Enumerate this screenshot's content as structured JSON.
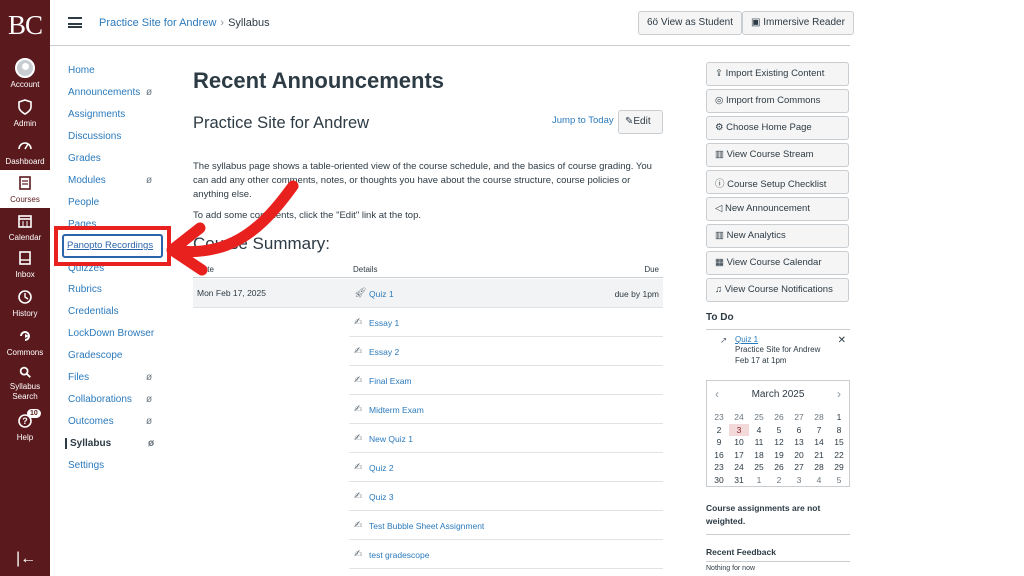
{
  "global_nav": {
    "logo": "BC",
    "items": [
      {
        "label": "Account",
        "icon": "avatar"
      },
      {
        "label": "Admin",
        "icon": "shield-icon"
      },
      {
        "label": "Dashboard",
        "icon": "dashboard-icon"
      },
      {
        "label": "Courses",
        "icon": "book-icon"
      },
      {
        "label": "Calendar",
        "icon": "calendar-icon"
      },
      {
        "label": "Inbox",
        "icon": "inbox-icon"
      },
      {
        "label": "History",
        "icon": "clock-icon"
      },
      {
        "label": "Commons",
        "icon": "commons-icon"
      },
      {
        "label": "Syllabus Search",
        "icon": "search-icon"
      },
      {
        "label": "Help",
        "icon": "help-icon",
        "badge": "10"
      }
    ],
    "collapse": "|←"
  },
  "header": {
    "breadcrumb_course": "Practice Site for Andrew",
    "breadcrumb_sep": "›",
    "breadcrumb_page": "Syllabus",
    "view_as_student": "View as Student",
    "immersive_reader": "Immersive Reader"
  },
  "course_nav": {
    "items": [
      {
        "label": "Home"
      },
      {
        "label": "Announcements",
        "hidden": true
      },
      {
        "label": "Assignments"
      },
      {
        "label": "Discussions"
      },
      {
        "label": "Grades"
      },
      {
        "label": "Modules",
        "hidden": true
      },
      {
        "label": "People"
      },
      {
        "label": "Pages"
      },
      {
        "label": "Panopto Recordings"
      },
      {
        "label": "Quizzes"
      },
      {
        "label": "Rubrics"
      },
      {
        "label": "Credentials"
      },
      {
        "label": "LockDown Browser"
      },
      {
        "label": "Gradescope"
      },
      {
        "label": "Files",
        "hidden": true
      },
      {
        "label": "Collaborations",
        "hidden": true
      },
      {
        "label": "Outcomes",
        "hidden": true
      },
      {
        "label": "Syllabus",
        "hidden": true,
        "active": true
      },
      {
        "label": "Settings"
      }
    ]
  },
  "main": {
    "title": "Recent Announcements",
    "course_title": "Practice Site for Andrew",
    "jump_to_today": "Jump to Today",
    "edit": "Edit",
    "description": "The syllabus page shows a table-oriented view of the course schedule, and the basics of course grading. You can add any other comments, notes, or thoughts you have about the course structure, course policies or anything else.",
    "edit_hint": "To add some comments, click the \"Edit\" link at the top.",
    "summary_title": "Course Summary:",
    "table": {
      "headers": {
        "date": "Date",
        "details": "Details",
        "due": "Due"
      },
      "date": "Mon Feb 17, 2025",
      "rows": [
        {
          "name": "Quiz 1",
          "due": "due by 1pm",
          "icon": "quiz-icon"
        },
        {
          "name": "Essay 1",
          "due": "",
          "icon": "assignment-icon"
        },
        {
          "name": "Essay 2",
          "due": "",
          "icon": "assignment-icon"
        },
        {
          "name": "Final Exam",
          "due": "",
          "icon": "assignment-icon"
        },
        {
          "name": "Midterm Exam",
          "due": "",
          "icon": "assignment-icon"
        },
        {
          "name": "New Quiz 1",
          "due": "",
          "icon": "assignment-icon"
        },
        {
          "name": "Quiz 2",
          "due": "",
          "icon": "assignment-icon"
        },
        {
          "name": "Quiz 3",
          "due": "",
          "icon": "assignment-icon"
        },
        {
          "name": "Test Bubble Sheet Assignment",
          "due": "",
          "icon": "assignment-icon"
        },
        {
          "name": "test gradescope",
          "due": "",
          "icon": "assignment-icon"
        }
      ]
    }
  },
  "sidebar": {
    "buttons": [
      {
        "label": "Import Existing Content",
        "icon": "import-icon"
      },
      {
        "label": "Import from Commons",
        "icon": "commons-icon"
      },
      {
        "label": "Choose Home Page",
        "icon": "home-icon"
      },
      {
        "label": "View Course Stream",
        "icon": "stream-icon"
      },
      {
        "label": "Course Setup Checklist",
        "icon": "checklist-icon"
      },
      {
        "label": "New Announcement",
        "icon": "announcement-icon"
      },
      {
        "label": "New Analytics",
        "icon": "analytics-icon"
      },
      {
        "label": "View Course Calendar",
        "icon": "calendar-icon"
      },
      {
        "label": "View Course Notifications",
        "icon": "bell-icon"
      }
    ],
    "todo": {
      "heading": "To Do",
      "item_name": "Quiz 1",
      "item_course": "Practice Site for Andrew",
      "item_date": "Feb 17 at 1pm",
      "close": "✕"
    },
    "calendar": {
      "month": "March 2025",
      "weeks": [
        [
          "23",
          "24",
          "25",
          "26",
          "27",
          "28",
          "1"
        ],
        [
          "2",
          "3",
          "4",
          "5",
          "6",
          "7",
          "8"
        ],
        [
          "9",
          "10",
          "11",
          "12",
          "13",
          "14",
          "15"
        ],
        [
          "16",
          "17",
          "18",
          "19",
          "20",
          "21",
          "22"
        ],
        [
          "23",
          "24",
          "25",
          "26",
          "27",
          "28",
          "29"
        ],
        [
          "30",
          "31",
          "1",
          "2",
          "3",
          "4",
          "5"
        ]
      ],
      "today": "3"
    },
    "weight_note": "Course assignments are not weighted.",
    "feedback_heading": "Recent Feedback",
    "feedback_empty": "Nothing for now"
  },
  "annotation": {
    "color": "#e8201e"
  },
  "colors": {
    "nav_bg": "#5a1a1d",
    "link": "#2b7abc"
  }
}
